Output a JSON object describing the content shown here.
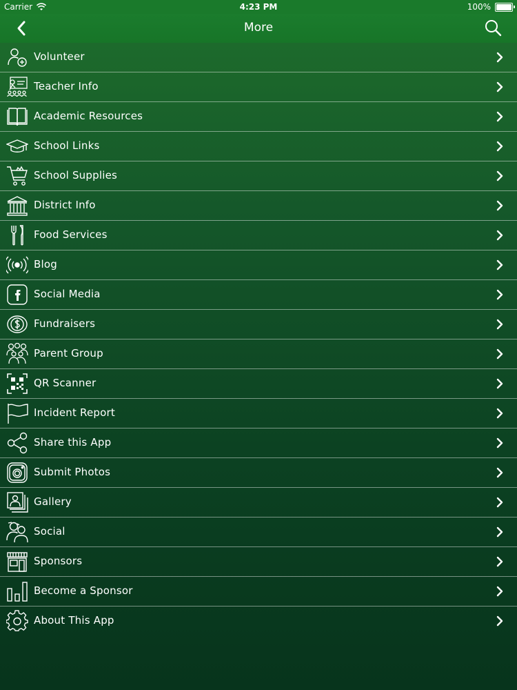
{
  "status_bar": {
    "carrier": "Carrier",
    "time": "4:23 PM",
    "battery": "100%"
  },
  "nav": {
    "title": "More",
    "back_icon": "chevron-left-icon",
    "search_icon": "search-icon"
  },
  "menu": {
    "items": [
      {
        "label": "Volunteer",
        "icon": "volunteer-icon"
      },
      {
        "label": "Teacher Info",
        "icon": "teacher-icon"
      },
      {
        "label": "Academic Resources",
        "icon": "book-icon"
      },
      {
        "label": "School Links",
        "icon": "graduation-cap-icon"
      },
      {
        "label": "School Supplies",
        "icon": "shopping-cart-icon"
      },
      {
        "label": "District Info",
        "icon": "building-icon"
      },
      {
        "label": "Food Services",
        "icon": "fork-knife-icon"
      },
      {
        "label": "Blog",
        "icon": "broadcast-icon"
      },
      {
        "label": "Social Media",
        "icon": "facebook-icon"
      },
      {
        "label": "Fundraisers",
        "icon": "dollar-coin-icon"
      },
      {
        "label": "Parent Group",
        "icon": "group-icon"
      },
      {
        "label": "QR Scanner",
        "icon": "qr-code-icon"
      },
      {
        "label": "Incident Report",
        "icon": "flag-icon"
      },
      {
        "label": "Share this App",
        "icon": "share-icon"
      },
      {
        "label": "Submit Photos",
        "icon": "camera-icon"
      },
      {
        "label": "Gallery",
        "icon": "gallery-icon"
      },
      {
        "label": "Social",
        "icon": "people-icon"
      },
      {
        "label": "Sponsors",
        "icon": "storefront-icon"
      },
      {
        "label": "Become a Sponsor",
        "icon": "bar-chart-icon"
      },
      {
        "label": "About This App",
        "icon": "gear-icon"
      }
    ]
  },
  "colors": {
    "accent": "#1a7a2b",
    "background_top": "#1f6f2c",
    "background_bottom": "#07341c",
    "text": "#ffffff"
  }
}
